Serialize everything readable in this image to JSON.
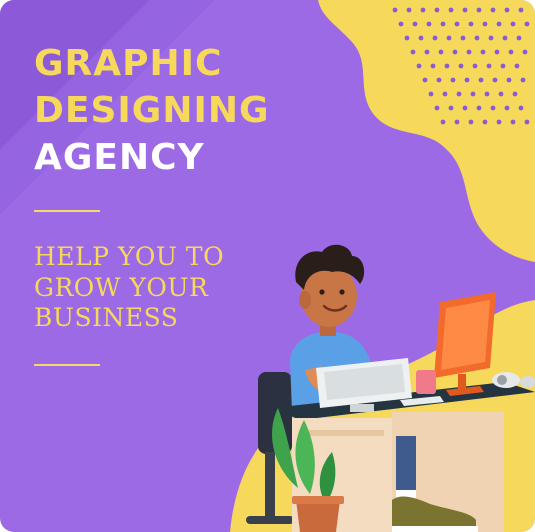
{
  "headline": {
    "line1": "GRAPHIC",
    "line2": "DESIGNING",
    "line3": "AGENCY"
  },
  "tagline": {
    "line1": "HELP YOU TO",
    "line2": "GROW YOUR",
    "line3": "BUSINESS"
  },
  "colors": {
    "background": "#9d6ae6",
    "accent_yellow": "#f6d95a",
    "headline_white": "#ffffff",
    "dots": "#8a5bd6"
  },
  "illustration": "person-at-computer-desk"
}
